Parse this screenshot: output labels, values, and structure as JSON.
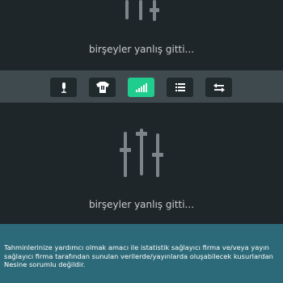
{
  "error_message_top": "birşeyler yanlış gitti...",
  "error_message_bottom": "birşeyler yanlış gitti...",
  "toolbar": {
    "buttons": [
      {
        "icon": "microphone-icon",
        "active": false
      },
      {
        "icon": "jersey-icon",
        "active": false
      },
      {
        "icon": "signal-bars-icon",
        "active": true
      },
      {
        "icon": "list-icon",
        "active": false
      },
      {
        "icon": "swap-arrows-icon",
        "active": false
      }
    ],
    "active_color": "#1fce8e"
  },
  "disclaimer": "Tahminlerinize yardımcı olmak amacı ile istatistik sağlayıcı firma ve/veya yayın sağlayıcı firma tarafından sunulan verilerde/yayınlarda oluşabilecek kusurlardan Nesine sorumlu değildir.",
  "colors": {
    "background": "#1e2629",
    "toolbar": "#3f4a4f",
    "disclaimer": "#2d6a79"
  }
}
